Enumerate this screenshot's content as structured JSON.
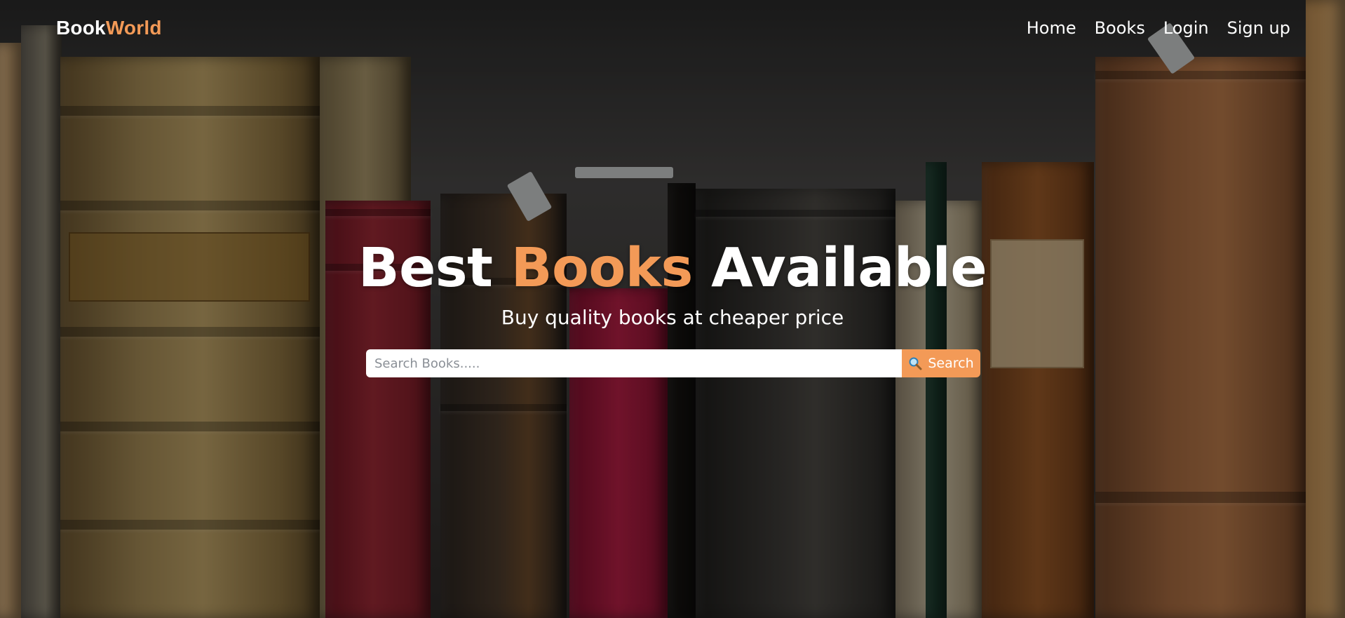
{
  "brand": {
    "name_part1": "Book",
    "name_part2": "World",
    "accent_color": "#f39a57"
  },
  "nav": {
    "links": [
      {
        "label": "Home"
      },
      {
        "label": "Books"
      },
      {
        "label": "Login"
      },
      {
        "label": "Sign up"
      }
    ]
  },
  "hero": {
    "title_prefix": "Best",
    "title_accent": "Books",
    "title_suffix": "Available",
    "subtitle": "Buy quality books at cheaper price"
  },
  "search": {
    "placeholder": "Search Books.....",
    "value": "",
    "button_label": "Search",
    "button_icon": "magnifier-icon",
    "button_color": "#f39a57"
  }
}
